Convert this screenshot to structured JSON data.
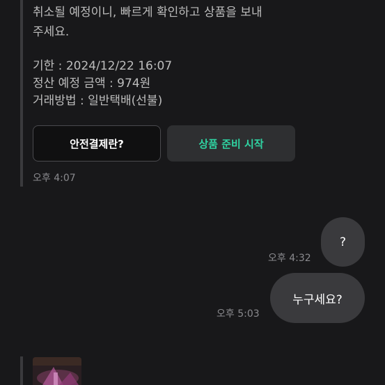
{
  "message": {
    "line1": "취소될 예정이니, 빠르게 확인하고 상품을 보내",
    "line2": "주세요.",
    "deadline": "기한 : 2024/12/22 16:07",
    "amount": "정산 예정 금액 : 974원",
    "method": "거래방법 : 일반택배(선불)"
  },
  "buttons": {
    "safe_payment": "안전결제란?",
    "start_preparing": "상품 준비 시작"
  },
  "timestamps": {
    "incoming": "오후 4:07",
    "outgoing1": "오후 4:32",
    "outgoing2": "오후 5:03"
  },
  "outgoing": {
    "msg1": "?",
    "msg2": "누구세요?"
  },
  "colors": {
    "accent_green": "#2fd3a2",
    "bubble": "#3a3a3d",
    "background": "#18181a"
  }
}
